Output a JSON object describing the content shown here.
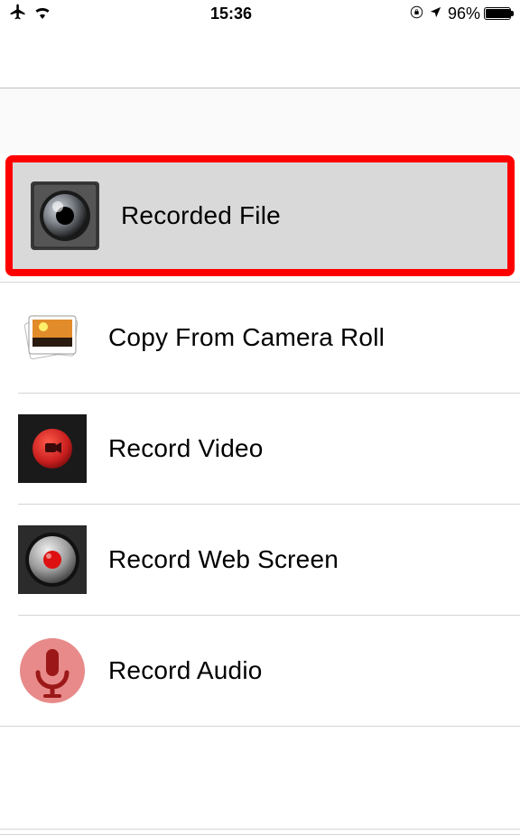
{
  "status_bar": {
    "time": "15:36",
    "battery_percent_label": "96%",
    "battery_fill_percent": 96
  },
  "menu": {
    "items": [
      {
        "label": "Recorded File",
        "highlighted": true
      },
      {
        "label": "Copy From Camera Roll"
      },
      {
        "label": "Record Video"
      },
      {
        "label": "Record Web Screen"
      },
      {
        "label": "Record Audio"
      }
    ]
  }
}
